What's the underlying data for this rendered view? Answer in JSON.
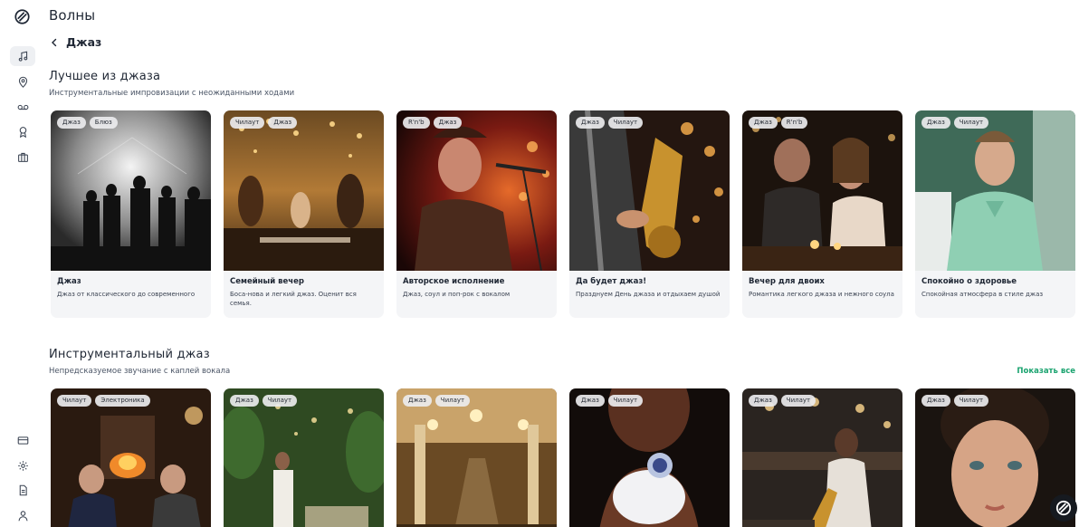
{
  "app": {
    "title": "Волны"
  },
  "breadcrumb": {
    "label": "Джаз"
  },
  "sidebar": {
    "items": [
      {
        "icon": "music-note-icon",
        "active": true
      },
      {
        "icon": "map-pin-icon",
        "active": false
      },
      {
        "icon": "voicemail-icon",
        "active": false
      },
      {
        "icon": "award-icon",
        "active": false
      },
      {
        "icon": "briefcase-icon",
        "active": false
      }
    ],
    "bottom": [
      {
        "icon": "credit-card-icon"
      },
      {
        "icon": "gear-icon"
      },
      {
        "icon": "document-icon"
      },
      {
        "icon": "user-icon"
      }
    ]
  },
  "sections": [
    {
      "title": "Лучшее из джаза",
      "subtitle": "Инструментальные импровизации с неожиданными ходами",
      "cards": [
        {
          "tags": [
            "Джаз",
            "Блюз"
          ],
          "title": "Джаз",
          "desc": "Джаз от классического до современного"
        },
        {
          "tags": [
            "Чилаут",
            "Джаз"
          ],
          "title": "Семейный вечер",
          "desc": "Боса-нова и легкий джаз. Оценит вся семья."
        },
        {
          "tags": [
            "R'n'b",
            "Джаз"
          ],
          "title": "Авторское исполнение",
          "desc": "Джаз, соул и поп-рок с вокалом"
        },
        {
          "tags": [
            "Джаз",
            "Чилаут"
          ],
          "title": "Да будет джаз!",
          "desc": "Празднуем День джаза и отдыхаем душой"
        },
        {
          "tags": [
            "Джаз",
            "R'n'b"
          ],
          "title": "Вечер для двоих",
          "desc": "Романтика легкого джаза и нежного соула"
        },
        {
          "tags": [
            "Джаз",
            "Чилаут"
          ],
          "title": "Спокойно о здоровье",
          "desc": "Спокойная атмосфера в стиле джаз"
        }
      ]
    },
    {
      "title": "Инструментальный джаз",
      "subtitle": "Непредсказуемое звучание с каплей вокала",
      "show_all": "Показать все",
      "cards": [
        {
          "tags": [
            "Чилаут",
            "Электроника"
          ]
        },
        {
          "tags": [
            "Джаз",
            "Чилаут"
          ]
        },
        {
          "tags": [
            "Джаз",
            "Чилаут"
          ]
        },
        {
          "tags": [
            "Джаз",
            "Чилаут"
          ]
        },
        {
          "tags": [
            "Джаз",
            "Чилаут"
          ]
        },
        {
          "tags": [
            "Джаз",
            "Чилаут"
          ]
        }
      ]
    }
  ],
  "colors": {
    "accent": "#1aa36f",
    "card_bg": "#f4f5f7",
    "text": "#1f2734"
  }
}
